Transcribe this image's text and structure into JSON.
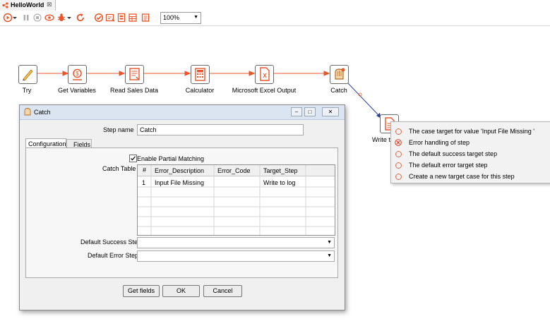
{
  "tab": {
    "title": "HelloWorld",
    "close": "⊠"
  },
  "toolbar": {
    "icons": [
      "run-icon",
      "run-dropdown-icon",
      "pause-icon",
      "stop-icon",
      "preview-icon",
      "debug-icon",
      "debug-dropdown-icon",
      "replay-icon",
      "verify-icon",
      "impact-icon",
      "sql-icon",
      "explore-db-icon",
      "show-results-icon"
    ],
    "zoom": "100%"
  },
  "steps": [
    {
      "name": "try",
      "label": "Try"
    },
    {
      "name": "get-variables",
      "label": "Get Variables"
    },
    {
      "name": "read-sales-data",
      "label": "Read Sales Data"
    },
    {
      "name": "calculator",
      "label": "Calculator"
    },
    {
      "name": "microsoft-excel-output",
      "label": "Microsoft Excel Output"
    },
    {
      "name": "catch",
      "label": "Catch"
    },
    {
      "name": "write-to-log",
      "label": "Write t"
    }
  ],
  "dialog": {
    "title": "Catch",
    "step_name_label": "Step name",
    "step_name_value": "Catch",
    "tabs": [
      "Configuration",
      "Fields"
    ],
    "enable_partial_matching": "Enable Partial Matching",
    "catch_table_label": "Catch Table",
    "table": {
      "headers": [
        "#",
        "Error_Description",
        "Error_Code",
        "Target_Step"
      ],
      "rows": [
        [
          "1",
          "Input File Missing",
          "",
          "Write to log"
        ]
      ]
    },
    "default_success_label": "Default Success Step",
    "default_error_label": "Default Error Step",
    "buttons": {
      "get_fields": "Get fields",
      "ok": "OK",
      "cancel": "Cancel"
    }
  },
  "context_menu": {
    "items": [
      "The case target for value 'Input File Missing '",
      "Error handling of step",
      "The default success target step",
      "The default error target step",
      "Create a new target case for this step"
    ]
  },
  "colors": {
    "accent": "#e8552b",
    "hop": "#e8552b",
    "error_hop": "#2f3f9e",
    "dialog_title": "#dbe5f1"
  }
}
